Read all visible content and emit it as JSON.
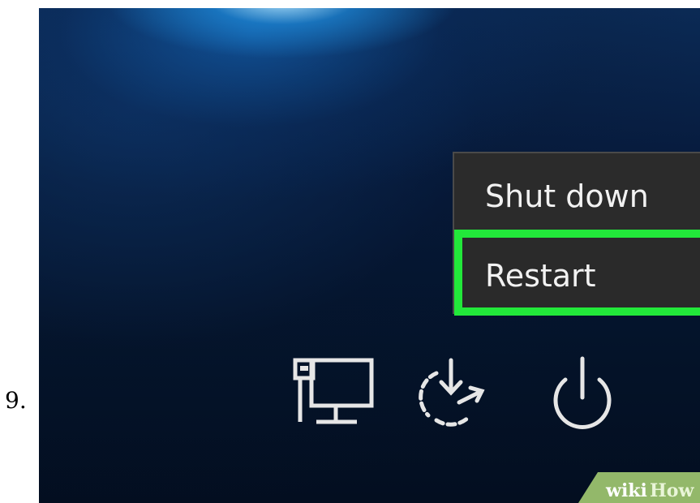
{
  "step": {
    "number": "9."
  },
  "power_menu": {
    "items": [
      {
        "label": "Shut down",
        "highlighted": false
      },
      {
        "label": "Restart",
        "highlighted": true
      }
    ],
    "highlight_color": "#22e83a"
  },
  "bottom_icons": [
    "network-icon",
    "ease-of-access-icon",
    "power-icon"
  ],
  "watermark": {
    "text_part1": "wiki",
    "text_part2": "How"
  }
}
